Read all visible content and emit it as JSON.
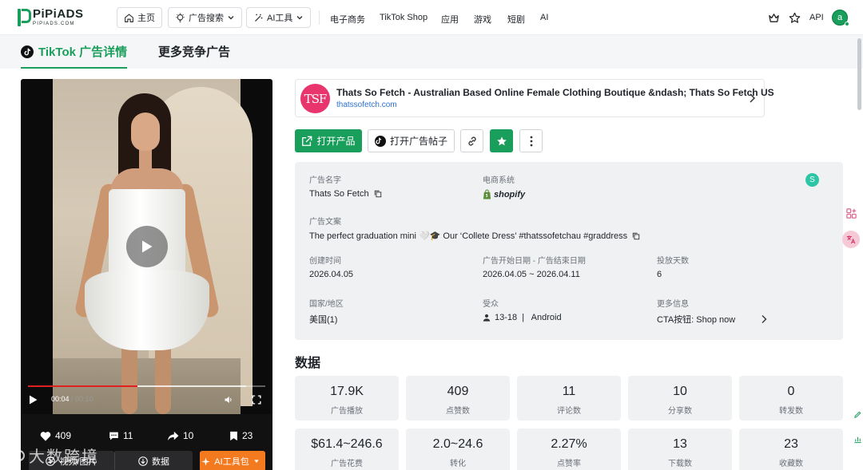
{
  "brand": {
    "name": "PiPiADS",
    "sub": "PIPIADS.COM"
  },
  "nav": {
    "home": "主页",
    "ad_search": "广告搜索",
    "ai_tools": "AI工具",
    "links": [
      "电子商务",
      "TikTok Shop",
      "应用",
      "游戏",
      "短剧",
      "AI"
    ],
    "api": "API",
    "avatar_letter": "a"
  },
  "tabs": {
    "active": "TikTok 广告详情",
    "other": "更多竞争广告"
  },
  "video": {
    "time_current": "00:04",
    "time_total": "00:10",
    "progress": 0.46,
    "buffered": 0.92,
    "stats": {
      "likes": "409",
      "comments": "11",
      "shares": "10",
      "saves": "23"
    },
    "buttons": {
      "download": "视频/图片",
      "data": "数据",
      "ai_pack": "AI工具包"
    }
  },
  "shop": {
    "logo_text": "TSF",
    "title": "Thats So Fetch - Australian Based Online Female Clothing Boutique &ndash; Thats So Fetch US",
    "url": "thatssofetch.com"
  },
  "actions": {
    "open_product": "打开产品",
    "open_post": "打开广告帖子"
  },
  "info": {
    "ad_name_label": "广告名字",
    "ad_name": "Thats So Fetch",
    "ecom_label": "电商系统",
    "ecom_value": "shopify",
    "badge": "S",
    "copy_label": "广告文案",
    "copy_text": "The perfect graduation mini 🤍🎓 Our ‘Collete Dress’ #thatssofetchau #graddress",
    "created_label": "创建时间",
    "created": "2026.04.05",
    "period_label": "广告开始日期 - 广告结束日期",
    "period": "2026.04.05 ~ 2026.04.11",
    "days_label": "投放天数",
    "days": "6",
    "region_label": "国家/地区",
    "region": "美国(1)",
    "audience_label": "受众",
    "audience": "13-18  |   Android",
    "more_label": "更多信息",
    "more": "CTA按钮: Shop now"
  },
  "data_section": {
    "title": "数据",
    "metrics": [
      {
        "value": "17.9K",
        "label": "广告播放"
      },
      {
        "value": "409",
        "label": "点赞数"
      },
      {
        "value": "11",
        "label": "评论数"
      },
      {
        "value": "10",
        "label": "分享数"
      },
      {
        "value": "0",
        "label": "转发数"
      },
      {
        "value": "$61.4~246.6",
        "label": "广告花费"
      },
      {
        "value": "2.0~24.6",
        "label": "转化"
      },
      {
        "value": "2.27%",
        "label": "点赞率"
      },
      {
        "value": "13",
        "label": "下载数"
      },
      {
        "value": "23",
        "label": "收藏数"
      }
    ]
  },
  "watermark": "大数跨境",
  "colors": {
    "accent": "#1a9e5c",
    "ai_orange": "#f47a1f",
    "link": "#2f6fd6"
  }
}
